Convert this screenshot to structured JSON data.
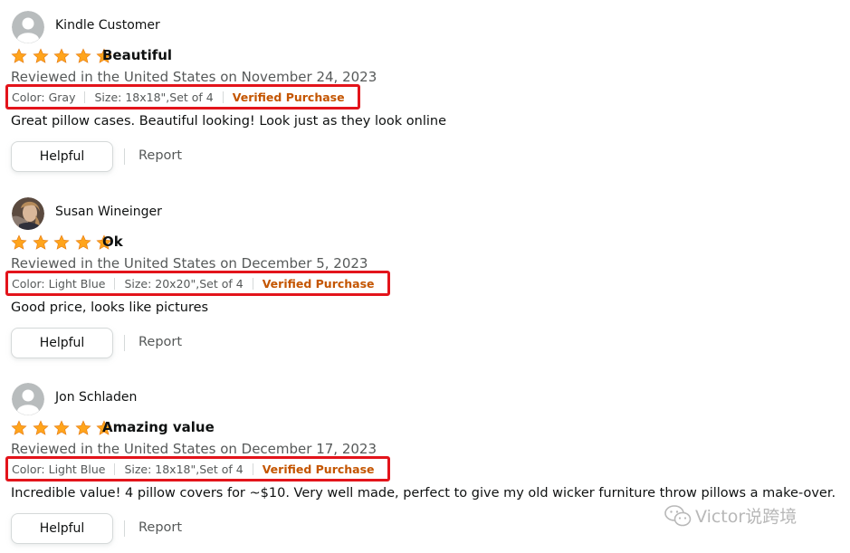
{
  "colors": {
    "star": "#ffa41c",
    "highlight_box": "#e3141b",
    "verified": "#c45500",
    "muted_text": "#565959"
  },
  "reviews": [
    {
      "reviewer": "Kindle Customer",
      "avatar": "default-person-icon",
      "rating": 5,
      "title": "Beautiful",
      "date": "Reviewed in the United States on November 24, 2023",
      "color": "Color: Gray",
      "size": "Size: 18x18\",Set of 4",
      "verified": "Verified Purchase",
      "body": "Great pillow cases. Beautiful looking! Look just as they look online",
      "helpful_label": "Helpful",
      "report_label": "Report"
    },
    {
      "reviewer": "Susan Wineinger",
      "avatar": "profile-photo",
      "rating": 5,
      "title": "Ok",
      "date": "Reviewed in the United States on December 5, 2023",
      "color": "Color: Light Blue",
      "size": "Size: 20x20\",Set of 4",
      "verified": "Verified Purchase",
      "body": "Good price, looks like pictures",
      "helpful_label": "Helpful",
      "report_label": "Report"
    },
    {
      "reviewer": "Jon Schladen",
      "avatar": "default-person-icon",
      "rating": 5,
      "title": "Amazing value",
      "date": "Reviewed in the United States on December 17, 2023",
      "color": "Color: Light Blue",
      "size": "Size: 18x18\",Set of 4",
      "verified": "Verified Purchase",
      "body": "Incredible value! 4 pillow covers for ~$10. Very well made, perfect to give my old wicker furniture throw pillows a make-over.",
      "helpful_label": "Helpful",
      "report_label": "Report"
    }
  ],
  "watermark": {
    "text": "Victor说跨境",
    "icon": "wechat-icon"
  }
}
